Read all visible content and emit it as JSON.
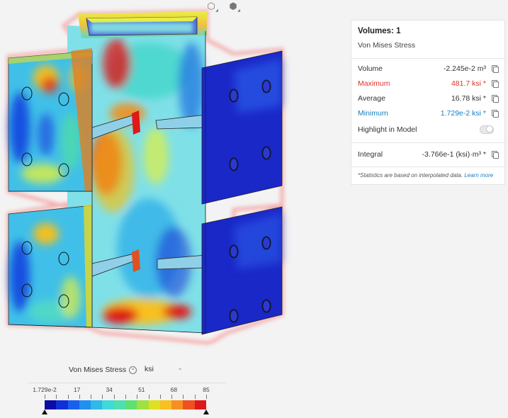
{
  "view_buttons": [
    {
      "icon": "wireframe-cube-icon",
      "glyph": "⬡"
    },
    {
      "icon": "solid-cube-icon",
      "glyph": "⬢"
    }
  ],
  "stats": {
    "title": "Volumes: 1",
    "subtitle": "Von Mises Stress",
    "rows": [
      {
        "label": "Volume",
        "value": "-2.245e-2 m³",
        "color": "normal"
      },
      {
        "label": "Maximum",
        "value": "481.7 ksi *",
        "color": "red"
      },
      {
        "label": "Average",
        "value": "16.78 ksi *",
        "color": "normal"
      },
      {
        "label": "Minimum",
        "value": "1.729e-2 ksi *",
        "color": "blue"
      }
    ],
    "highlight_label": "Highlight in Model",
    "highlight_on": false,
    "integral_label": "Integral",
    "integral_value": "-3.766e-1 (ksi)·m³ *",
    "note": "*Statistics are based on interpolated data.",
    "note_link": "Learn more"
  },
  "legend": {
    "title": "Von Mises Stress",
    "unit": "ksi",
    "ticks": [
      "1.729e-2",
      "17",
      "34",
      "51",
      "68",
      "85"
    ],
    "colors": [
      "#0b0ba8",
      "#1030d8",
      "#1860ee",
      "#2090f0",
      "#30b8e8",
      "#40d8d8",
      "#50e0b0",
      "#60e070",
      "#a0e040",
      "#e0e020",
      "#f8c020",
      "#f89020",
      "#f05020",
      "#e01818"
    ]
  },
  "colors": {
    "deep_blue": "#1a28c8",
    "red": "#e01818",
    "outline": "#f08a8a"
  }
}
